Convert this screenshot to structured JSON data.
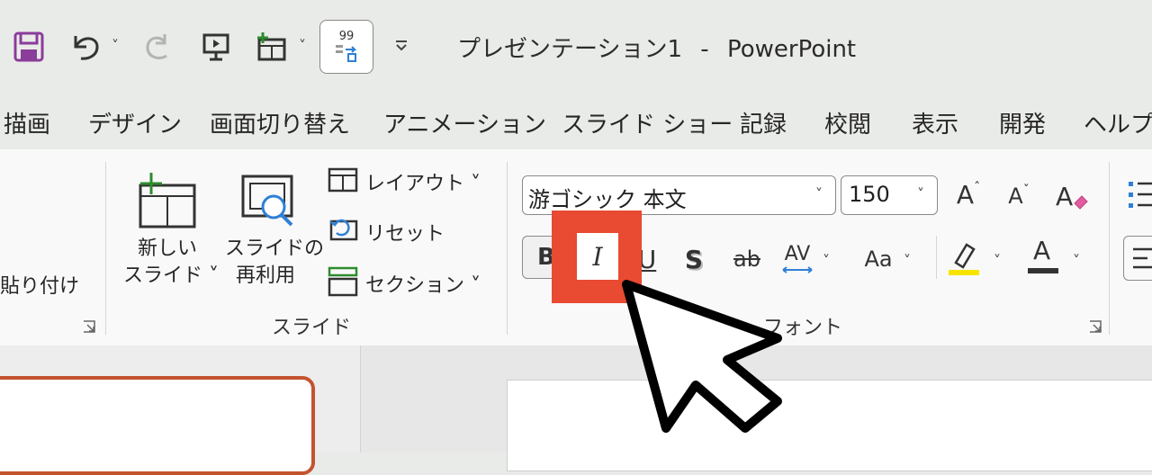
{
  "title_bar": {
    "document": "プレゼンテーション1",
    "separator": "-",
    "app": "PowerPoint",
    "qat": {
      "save_icon": "save-icon",
      "undo_icon": "undo-icon",
      "redo_icon": "redo-icon",
      "present_icon": "present-from-start-icon",
      "new_slide_icon": "new-slide-icon",
      "ocr_icon": "ocr-icon",
      "ocr_badge": "99",
      "customize_icon": "customize-qat-icon"
    }
  },
  "tabs": [
    {
      "label": "描画"
    },
    {
      "label": "デザイン"
    },
    {
      "label": "画面切り替え"
    },
    {
      "label": "アニメーション"
    },
    {
      "label": "スライド ショー"
    },
    {
      "label": "記録"
    },
    {
      "label": "校閲"
    },
    {
      "label": "表示"
    },
    {
      "label": "開発"
    },
    {
      "label": "ヘルプ"
    }
  ],
  "clipboard": {
    "paste_label": "貼り付け"
  },
  "slides_group": {
    "new_slide": {
      "line1": "新しい",
      "line2": "スライド ˅"
    },
    "reuse": {
      "line1": "スライドの",
      "line2": "再利用"
    },
    "layout": "レイアウト ˅",
    "reset": "リセット",
    "section": "セクション ˅",
    "group_label": "スライド"
  },
  "font_group": {
    "font_name": "游ゴシック 本文",
    "font_size": "150",
    "bold": "B",
    "italic": "I",
    "underline": "U",
    "shadow": "S",
    "strike": "ab",
    "spacing": "AV",
    "change_case": "Aa",
    "font_color": "A",
    "grow": "A",
    "shrink": "A",
    "group_label": "フォント"
  },
  "colors": {
    "highlight_box": "#e84a32",
    "save_icon": "#8a3d9a",
    "thumb_border": "#c4532f",
    "highlighter_yellow": "#f7e400"
  }
}
